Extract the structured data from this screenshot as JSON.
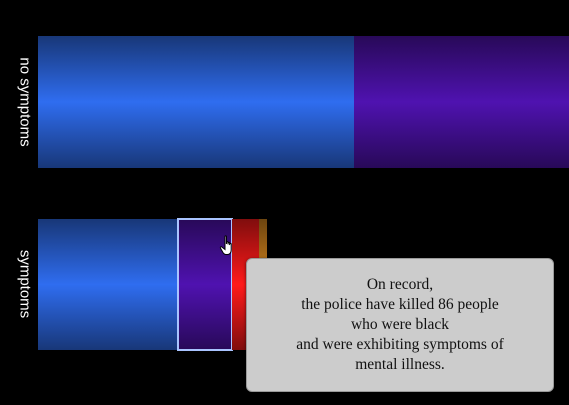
{
  "chart_data": {
    "type": "bar",
    "orientation": "horizontal-stacked",
    "categories": [
      "no symptoms",
      "symptoms"
    ],
    "series": [
      {
        "color": "#2f6df0",
        "values": [
          316,
          140
        ]
      },
      {
        "color": "#4f12b0",
        "values": [
          215,
          54
        ]
      },
      {
        "color": "#ff1a1a",
        "values": [
          0,
          27
        ]
      },
      {
        "color": "#d8871e",
        "values": [
          0,
          8
        ]
      }
    ],
    "highlighted": {
      "category": "symptoms",
      "series_index": 1
    },
    "title": "",
    "xlabel": "",
    "ylabel": "",
    "grid": false,
    "legend": "none"
  },
  "tooltip": {
    "lines": [
      "On record,",
      "the police have killed 86 people",
      "who were black",
      "and were exhibiting symptoms of",
      "mental illness."
    ]
  },
  "cursor": {
    "icon": "hand-pointer-icon"
  }
}
